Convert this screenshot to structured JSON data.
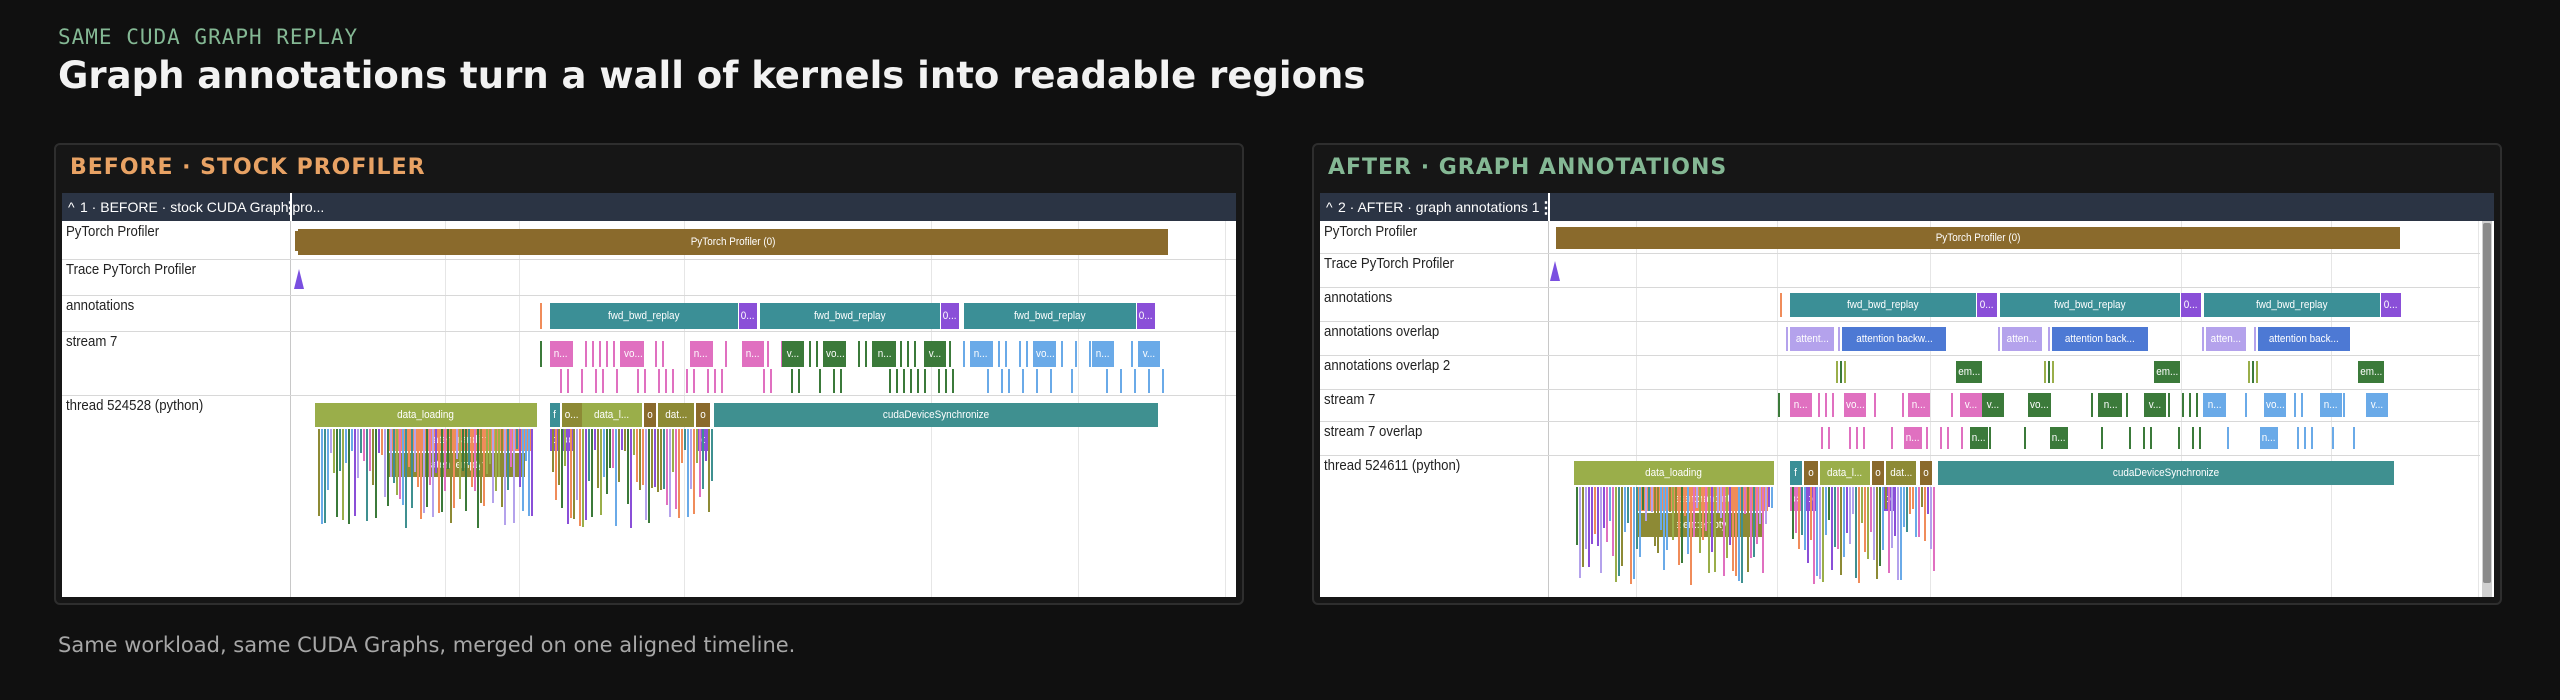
{
  "eyebrow": "SAME CUDA GRAPH REPLAY",
  "headline": "Graph annotations turn a wall of kernels into readable regions",
  "footnote": "Same workload, same CUDA Graphs, merged on one aligned timeline.",
  "colors": {
    "before_accent": "#e8a264",
    "after_accent": "#84b894",
    "track_header": "#2b3444",
    "profiler_bar": "#8a6a2c",
    "fwd_bwd": "#3b8f96",
    "short_violet": "#8a4fd8",
    "data_loading": "#9aae4a",
    "randint": "#f08c5a",
    "empty": "#8d8a35",
    "sync": "#3f9090",
    "attention_light": "#b4a2ec",
    "attention_blue": "#4d79d4",
    "stream_pink": "#e070c0",
    "stream_green": "#3b7a3a",
    "stream_blue": "#6aaae8"
  },
  "before": {
    "card_title": "BEFORE · STOCK PROFILER",
    "track_title": "1 · BEFORE · stock CUDA Graph pro...",
    "rows": [
      "PyTorch Profiler",
      "Trace PyTorch Profiler",
      "annotations",
      "stream 7",
      "thread 524528 (python)"
    ],
    "profiler_label": "PyTorch Profiler (0)",
    "annotations": [
      "fwd_bwd_replay",
      "fwd_bwd_replay",
      "fwd_bwd_replay"
    ],
    "short_label": "0...",
    "stream_labels": [
      "n...",
      "vo...",
      "n...",
      "n...",
      "v...",
      "vo...",
      "n...",
      "v...",
      "n...",
      "vo...",
      "n...",
      "v..."
    ],
    "thread": {
      "data_loading": "data_loading",
      "randint": "aten::randint",
      "empty": "aten::empty",
      "extra": [
        "f",
        "o...",
        "data_l...",
        "o",
        "dat...",
        "o"
      ],
      "small": [
        "c",
        "o"
      ],
      "sync": "cudaDeviceSynchronize"
    }
  },
  "after": {
    "card_title": "AFTER · GRAPH ANNOTATIONS",
    "track_title": "2 · AFTER · graph annotations 1",
    "rows": [
      "PyTorch Profiler",
      "Trace PyTorch Profiler",
      "annotations",
      "annotations overlap",
      "annotations overlap 2",
      "stream 7",
      "stream 7 overlap",
      "thread 524611 (python)"
    ],
    "profiler_label": "PyTorch Profiler (0)",
    "annotations": [
      "fwd_bwd_replay",
      "fwd_bwd_replay",
      "fwd_bwd_replay"
    ],
    "short_label": "0...",
    "overlap": [
      "attent...",
      "attention backw...",
      "atten...",
      "attention back...",
      "atten...",
      "attention back..."
    ],
    "overlap2_label": "em...",
    "stream_labels": [
      "n...",
      "vo...",
      "n...",
      "v...",
      "v...",
      "vo...",
      "n...",
      "v...",
      "n...",
      "vo...",
      "n...",
      "v..."
    ],
    "thread": {
      "data_loading": "data_loading",
      "randint": "aten::randint",
      "empty": "aten::empty",
      "extra": [
        "f",
        "o",
        "data_l...",
        "o",
        "dat...",
        "o"
      ],
      "small": [
        "c",
        "o"
      ],
      "sync": "cudaDeviceSynchronize"
    }
  }
}
